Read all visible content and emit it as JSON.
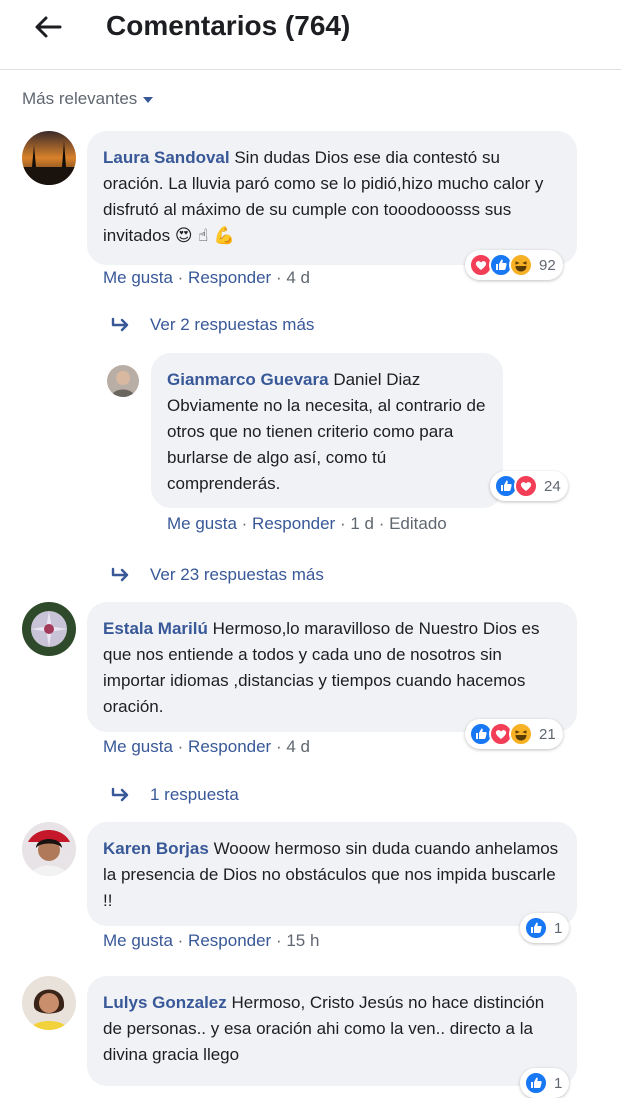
{
  "header": {
    "title": "Comentarios (764)"
  },
  "sort": {
    "label": "Más relevantes"
  },
  "colors": {
    "link": "#385898",
    "muted": "#606770",
    "bubble": "#f0f2f5",
    "like": "#1877f2",
    "love": "#f33e58",
    "haha": "#f7b125"
  },
  "comments": [
    {
      "author": "Laura Sandoval",
      "text": "Sin dudas Dios ese dia contestó su oración. La lluvia paró como se lo pidió,hizo mucho calor y disfrutó al máximo de su cumple con tooodooosss sus invitados",
      "emojis": "😍 ☝ 💪",
      "like": "Me gusta",
      "reply": "Responder",
      "time": "4 d",
      "reaction_icons": [
        "love",
        "like",
        "haha"
      ],
      "reaction_count": "92",
      "more_replies": "Ver 2 respuestas más"
    },
    {
      "author": "Estala Marilú",
      "text": "Hermoso,lo maravilloso de Nuestro Dios es que nos entiende a todos y cada uno de nosotros sin importar idiomas ,distancias y tiempos cuando hacemos oración.",
      "like": "Me gusta",
      "reply": "Responder",
      "time": "4 d",
      "reaction_icons": [
        "like",
        "love",
        "haha"
      ],
      "reaction_count": "21",
      "more_replies": "1 respuesta"
    },
    {
      "author": "Karen Borjas",
      "text": "Wooow hermoso sin duda cuando anhelamos la presencia de Dios no obstáculos que nos impida buscarle !!",
      "like": "Me gusta",
      "reply": "Responder",
      "time": "15 h",
      "reaction_icons": [
        "like"
      ],
      "reaction_count": "1"
    },
    {
      "author": "Lulys Gonzalez",
      "text": "Hermoso, Cristo Jesús no hace distinción de personas.. y esa oración ahi como la ven.. directo a la divina gracia llego",
      "reaction_icons": [
        "like"
      ],
      "reaction_count": "1"
    }
  ],
  "reply": {
    "author": "Gianmarco Guevara",
    "text": "Daniel Diaz Obviamente no la necesita, al contrario de otros que no tienen criterio como para burlarse de algo así, como tú comprenderás.",
    "like": "Me gusta",
    "reply": "Responder",
    "time": "1 d",
    "edited": "Editado",
    "reaction_icons": [
      "like",
      "love"
    ],
    "reaction_count": "24",
    "more_replies": "Ver 23 respuestas más"
  }
}
